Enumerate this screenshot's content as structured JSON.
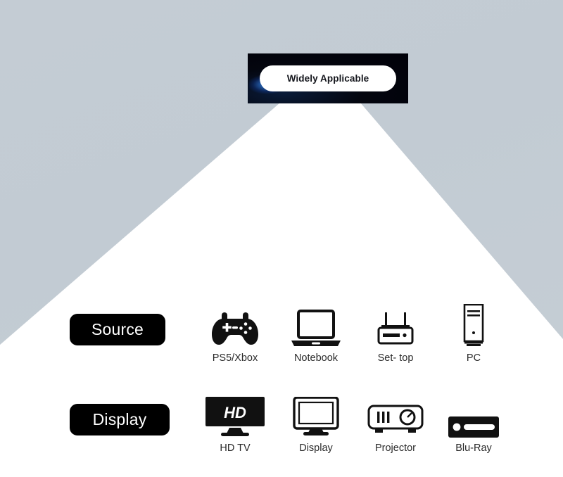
{
  "banner": {
    "pill_label": "Widely Applicable"
  },
  "colors": {
    "background": "#c4ccd4",
    "beam": "#ffffff",
    "banner": "#04060f",
    "tag": "#000000",
    "accent_glow": "#3c96ff",
    "caption_text": "#2a2a2a"
  },
  "rows": [
    {
      "tag_label": "Source",
      "items": [
        {
          "label": "PS5/Xbox",
          "icon": "gamepad-icon"
        },
        {
          "label": "Notebook",
          "icon": "laptop-icon"
        },
        {
          "label": "Set- top",
          "icon": "set-top-box-icon"
        },
        {
          "label": "PC",
          "icon": "desktop-tower-icon"
        }
      ]
    },
    {
      "tag_label": "Display",
      "items": [
        {
          "label": "HD TV",
          "icon": "hd-tv-icon",
          "screen_text": "HD"
        },
        {
          "label": "Display",
          "icon": "monitor-icon"
        },
        {
          "label": "Projector",
          "icon": "projector-icon"
        },
        {
          "label": "Blu-Ray",
          "icon": "blu-ray-player-icon"
        }
      ]
    }
  ]
}
